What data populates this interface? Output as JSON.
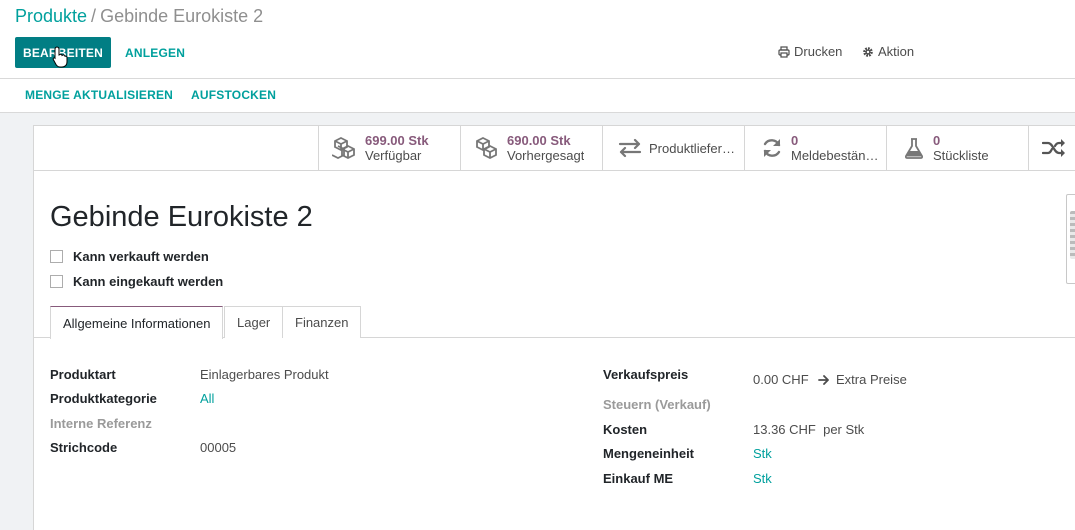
{
  "breadcrumb": {
    "parent": "Produkte",
    "separator": "/",
    "current": "Gebinde Eurokiste 2"
  },
  "toolbar": {
    "edit_label": "BEARBEITEN",
    "create_label": "ANLEGEN",
    "print_label": "Drucken",
    "action_label": "Aktion"
  },
  "statusbar": {
    "update_qty_label": "MENGE AKTUALISIEREN",
    "replenish_label": "AUFSTOCKEN"
  },
  "smart_buttons": [
    {
      "icon": "cubes-icon",
      "value": "699.00 Stk",
      "label": "Verfügbar"
    },
    {
      "icon": "cubes-icon",
      "value": "690.00 Stk",
      "label": "Vorhergesagt"
    },
    {
      "icon": "exchange-icon",
      "label": "Produktliefer…"
    },
    {
      "icon": "refresh-icon",
      "value": "0",
      "label": "Meldebestän…"
    },
    {
      "icon": "flask-icon",
      "value": "0",
      "label": "Stückliste"
    },
    {
      "icon": "random-icon"
    }
  ],
  "product": {
    "name": "Gebinde Eurokiste 2",
    "can_be_sold_label": "Kann verkauft werden",
    "can_be_purchased_label": "Kann eingekauft werden"
  },
  "tabs": [
    "Allgemeine Informationen",
    "Lager",
    "Finanzen"
  ],
  "general_info": {
    "left": [
      {
        "label": "Produktart",
        "value": "Einlagerbares Produkt"
      },
      {
        "label": "Produktkategorie",
        "value": "All"
      },
      {
        "label": "Interne Referenz",
        "value": ""
      },
      {
        "label": "Strichcode",
        "value": "00005"
      }
    ],
    "right": [
      {
        "label": "Verkaufspreis",
        "value": "0.00 CHF"
      },
      {
        "label": "Steuern (Verkauf)",
        "value": ""
      },
      {
        "label": "Kosten",
        "value": "13.36 CHF  per Stk"
      },
      {
        "label": "Mengeneinheit",
        "value": "Stk"
      },
      {
        "label": "Einkauf ME",
        "value": "Stk"
      }
    ],
    "extra_prices_label": "Extra Preise"
  },
  "colors": {
    "primary": "#017e84",
    "link": "#00a09d",
    "stat_value": "#875a7b"
  }
}
